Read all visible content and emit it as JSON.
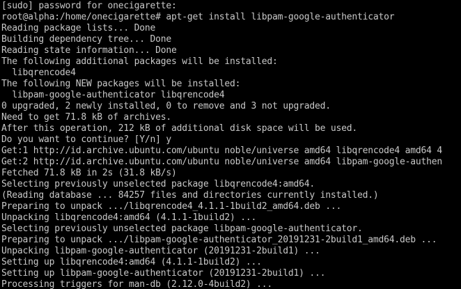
{
  "terminal": {
    "lines": [
      "[sudo] password for onecigarette:",
      "root@alpha:/home/onecigarette# apt-get install libpam-google-authenticator",
      "Reading package lists... Done",
      "Building dependency tree... Done",
      "Reading state information... Done",
      "The following additional packages will be installed:",
      "  libqrencode4",
      "The following NEW packages will be installed:",
      "  libpam-google-authenticator libqrencode4",
      "0 upgraded, 2 newly installed, 0 to remove and 3 not upgraded.",
      "Need to get 71.8 kB of archives.",
      "After this operation, 212 kB of additional disk space will be used.",
      "Do you want to continue? [Y/n] y",
      "Get:1 http://id.archive.ubuntu.com/ubuntu noble/universe amd64 libqrencode4 amd64 4",
      "Get:2 http://id.archive.ubuntu.com/ubuntu noble/universe amd64 libpam-google-authen",
      "Fetched 71.8 kB in 2s (31.8 kB/s)",
      "Selecting previously unselected package libqrencode4:amd64.",
      "(Reading database ... 84257 files and directories currently installed.)",
      "Preparing to unpack .../libqrencode4_4.1.1-1build2_amd64.deb ...",
      "Unpacking libqrencode4:amd64 (4.1.1-1build2) ...",
      "Selecting previously unselected package libpam-google-authenticator.",
      "Preparing to unpack .../libpam-google-authenticator_20191231-2build1_amd64.deb ...",
      "Unpacking libpam-google-authenticator (20191231-2build1) ...",
      "Setting up libqrencode4:amd64 (4.1.1-1build2) ...",
      "Setting up libpam-google-authenticator (20191231-2build1) ...",
      "Processing triggers for man-db (2.12.0-4build2) ..."
    ]
  },
  "colors": {
    "background": "#000000",
    "foreground": "#c8c8c8"
  }
}
